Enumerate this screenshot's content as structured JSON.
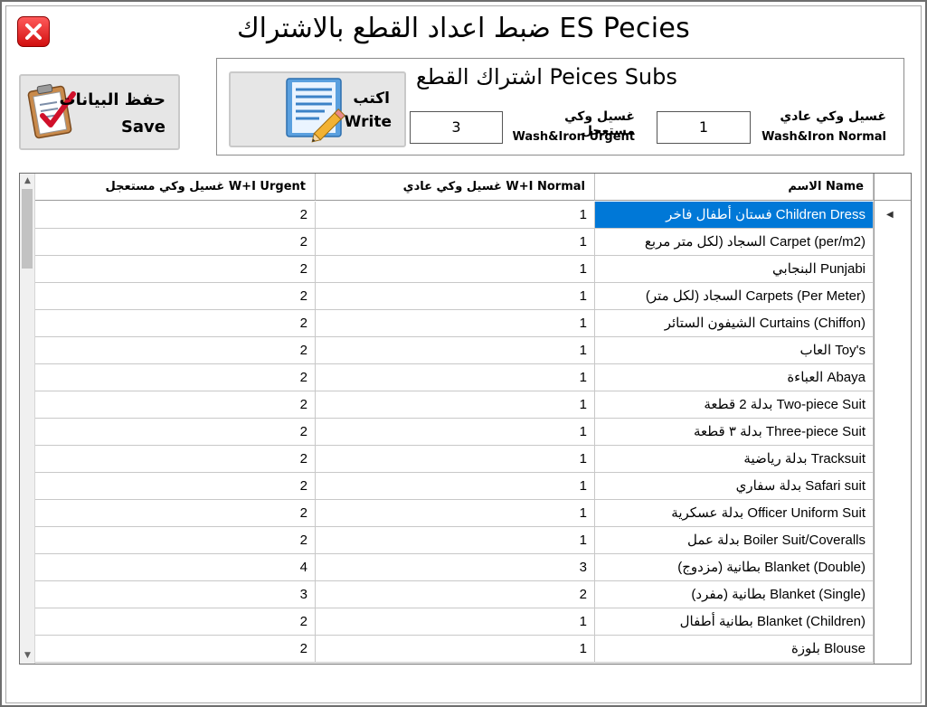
{
  "window": {
    "title": "ضبط اعداد القطع بالاشتراك ES Pecies"
  },
  "save_button": {
    "label_ar": "حفظ البيانات",
    "label_en": "Save",
    "icon": "clipboard-check-icon"
  },
  "subs_panel": {
    "title": "اشتراك القطع Peices Subs",
    "write_button": {
      "label_ar": "اكتب",
      "label_en": "Write",
      "icon": "notepad-pencil-icon"
    },
    "normal": {
      "label_ar": "غسيل وكي عادي",
      "label_en": "Wash&Iron Normal",
      "value": "1"
    },
    "urgent": {
      "label_ar": "غسيل وكي مستعجل",
      "label_en": "Wash&Iron Urgent",
      "value": "3"
    }
  },
  "grid": {
    "columns": {
      "name": "الاسم Name",
      "normal": "غسيل وكي عادي W+I Normal",
      "urgent": "غسيل وكي مستعجل W+I Urgent"
    },
    "selected_row": 0,
    "selection_color": "#0078d7",
    "rows": [
      {
        "name": "فستان أطفال فاخر Children Dress",
        "normal": "1",
        "urgent": "2"
      },
      {
        "name": "السجاد (لكل متر مربع Carpet (per/m2)",
        "normal": "1",
        "urgent": "2"
      },
      {
        "name": "البنجابي Punjabi",
        "normal": "1",
        "urgent": "2"
      },
      {
        "name": "السجاد (لكل متر) Carpets (Per Meter)",
        "normal": "1",
        "urgent": "2"
      },
      {
        "name": "الشيفون الستائر Curtains (Chiffon)",
        "normal": "1",
        "urgent": "2"
      },
      {
        "name": "العاب Toy's",
        "normal": "1",
        "urgent": "2"
      },
      {
        "name": "العباءة Abaya",
        "normal": "1",
        "urgent": "2"
      },
      {
        "name": "بدلة 2 قطعة Two-piece Suit",
        "normal": "1",
        "urgent": "2"
      },
      {
        "name": "بدلة ٣ قطعة Three-piece Suit",
        "normal": "1",
        "urgent": "2"
      },
      {
        "name": "بدلة رياضية Tracksuit",
        "normal": "1",
        "urgent": "2"
      },
      {
        "name": "بدلة سفاري Safari suit",
        "normal": "1",
        "urgent": "2"
      },
      {
        "name": "بدلة عسكرية Officer Uniform Suit",
        "normal": "1",
        "urgent": "2"
      },
      {
        "name": "بدلة عمل Boiler Suit/Coveralls",
        "normal": "1",
        "urgent": "2"
      },
      {
        "name": "بطانية (مزدوج) Blanket (Double)",
        "normal": "3",
        "urgent": "4"
      },
      {
        "name": "بطانية (مفرد) Blanket (Single)",
        "normal": "2",
        "urgent": "3"
      },
      {
        "name": "بطانية أطفال Blanket (Children)",
        "normal": "1",
        "urgent": "2"
      },
      {
        "name": "بلوزة Blouse",
        "normal": "1",
        "urgent": "2"
      }
    ]
  }
}
